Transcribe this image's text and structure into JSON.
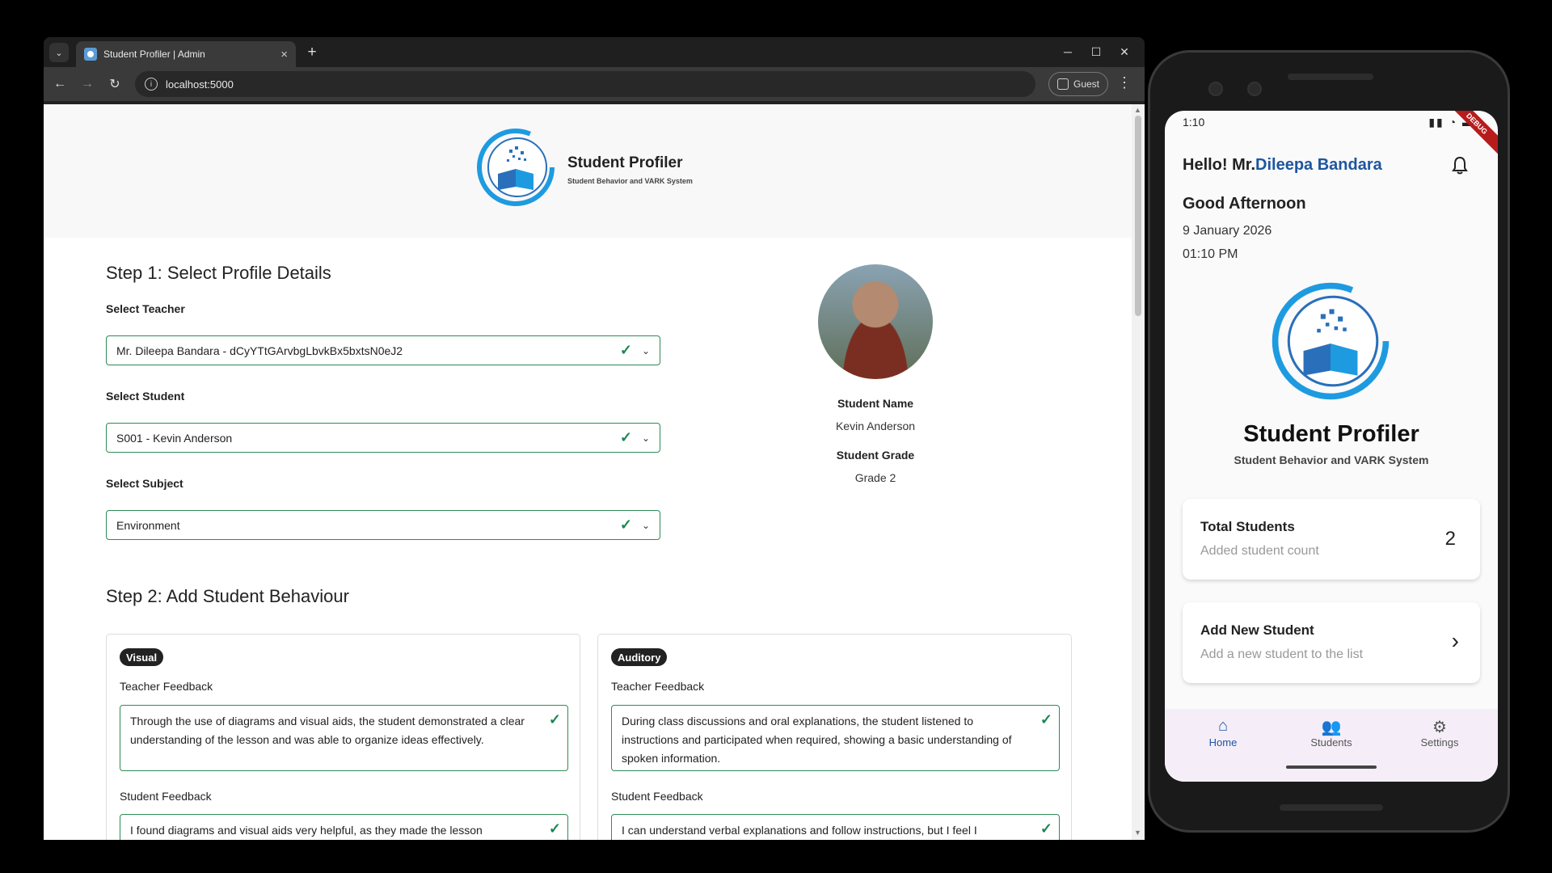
{
  "browser": {
    "tab_title": "Student Profiler | Admin",
    "url": "localhost:5000",
    "profile_label": "Guest"
  },
  "site": {
    "brand_title": "Student Profiler",
    "brand_subtitle": "Student Behavior and VARK System"
  },
  "step1": {
    "title": "Step 1: Select Profile Details",
    "teacher_label": "Select Teacher",
    "teacher_value": "Mr. Dileepa Bandara - dCyYTtGArvbgLbvkBx5bxtsN0eJ2",
    "student_label": "Select Student",
    "student_value": "S001 - Kevin Anderson",
    "subject_label": "Select Subject",
    "subject_value": "Environment"
  },
  "student_info": {
    "name_label": "Student Name",
    "name_value": "Kevin Anderson",
    "grade_label": "Student Grade",
    "grade_value": "Grade 2"
  },
  "step2": {
    "title": "Step 2: Add Student Behaviour",
    "cards": [
      {
        "badge": "Visual",
        "teacher_label": "Teacher Feedback",
        "teacher_text": "Through the use of diagrams and visual aids, the student demonstrated a clear understanding of the lesson and was able to organize ideas effectively.",
        "student_label": "Student Feedback",
        "student_text": "I found diagrams and visual aids very helpful, as they made the lesson"
      },
      {
        "badge": "Auditory",
        "teacher_label": "Teacher Feedback",
        "teacher_text": "During class discussions and oral explanations, the student listened to instructions and participated when required, showing a basic understanding of spoken information.",
        "student_label": "Student Feedback",
        "student_text": "I can understand verbal explanations and follow instructions, but I feel I"
      }
    ]
  },
  "phone": {
    "status_time": "1:10",
    "debug_label": "DEBUG",
    "hello_prefix": "Hello! Mr.",
    "hello_name": "Dileepa Bandara",
    "greeting": "Good Afternoon",
    "date": "9 January 2026",
    "time": "01:10 PM",
    "brand_title": "Student Profiler",
    "brand_subtitle": "Student Behavior and VARK System",
    "total_card": {
      "title": "Total Students",
      "subtitle": "Added student count",
      "count": "2"
    },
    "add_card": {
      "title": "Add New Student",
      "subtitle": "Add a new student to the list"
    },
    "nav": [
      "Home",
      "Students",
      "Settings"
    ]
  },
  "colors": {
    "valid_border": "#2e8b57",
    "check_green": "#198754",
    "brand_blue": "#1e56a0",
    "badge_bg": "#222222"
  },
  "icons": {
    "tab_search": "chevron-down-icon",
    "nav_back": "arrow-left-icon",
    "nav_forward": "arrow-right-icon",
    "reload": "reload-icon",
    "bell": "bell-icon"
  }
}
